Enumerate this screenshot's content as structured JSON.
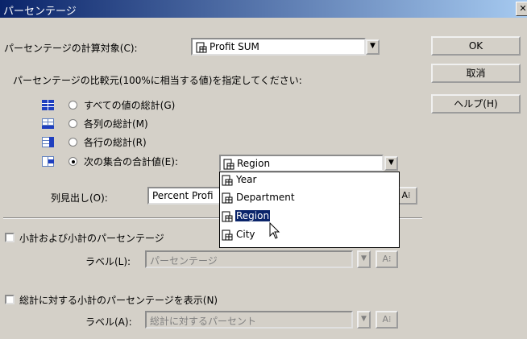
{
  "window": {
    "title": "パーセンテージ",
    "close_glyph": "✕"
  },
  "target": {
    "label": "パーセンテージの計算対象(C):",
    "value": "Profit SUM"
  },
  "buttons": {
    "ok": "OK",
    "cancel": "取消",
    "help": "ヘルプ(H)"
  },
  "base": {
    "heading": "パーセンテージの比較元(100%に相当する値)を指定してください:",
    "options": [
      {
        "label": "すべての値の総計(G)",
        "icon": "grand-total-icon",
        "checked": false
      },
      {
        "label": "各列の総計(M)",
        "icon": "column-total-icon",
        "checked": false
      },
      {
        "label": "各行の総計(R)",
        "icon": "row-total-icon",
        "checked": false
      },
      {
        "label": "次の集合の合計値(E):",
        "icon": "set-total-icon",
        "checked": true
      }
    ],
    "set_value": "Region"
  },
  "dropdown": {
    "items": [
      "Year",
      "Department",
      "Region",
      "City"
    ],
    "selected": "Region"
  },
  "column_header": {
    "label": "列見出し(O):",
    "value": "Percent Profi"
  },
  "subtotal": {
    "checkbox_label": "小計および小計のパーセンテージ",
    "label_label": "ラベル(L):",
    "label_value": "パーセンテージ",
    "checked": false
  },
  "total": {
    "checkbox_label": "総計に対する小計のパーセンテージを表示(N)",
    "label_label": "ラベル(A):",
    "label_value": "総計に対するパーセント",
    "checked": false
  },
  "colors": {
    "title_start": "#0a246a",
    "title_end": "#a6caf0",
    "dialog_bg": "#d4d0c8",
    "selection": "#0a246a"
  },
  "glyphs": {
    "combo_arrow": "▼",
    "format_button": "A⁝"
  }
}
